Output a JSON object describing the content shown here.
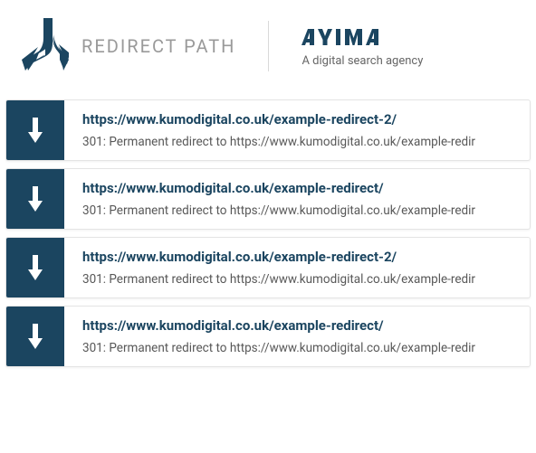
{
  "header": {
    "app_title": "REDIRECT PATH",
    "agency_name": "AYIMA",
    "agency_tagline": "A digital search agency"
  },
  "redirects": [
    {
      "url": "https://www.kumodigital.co.uk/example-redirect-2/",
      "status": "301: Permanent redirect to https://www.kumodigital.co.uk/example-redir"
    },
    {
      "url": "https://www.kumodigital.co.uk/example-redirect/",
      "status": "301: Permanent redirect to https://www.kumodigital.co.uk/example-redir"
    },
    {
      "url": "https://www.kumodigital.co.uk/example-redirect-2/",
      "status": "301: Permanent redirect to https://www.kumodigital.co.uk/example-redir"
    },
    {
      "url": "https://www.kumodigital.co.uk/example-redirect/",
      "status": "301: Permanent redirect to https://www.kumodigital.co.uk/example-redir"
    }
  ]
}
